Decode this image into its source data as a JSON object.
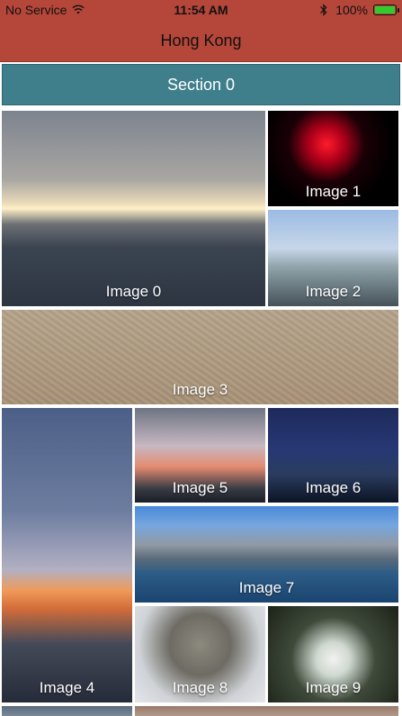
{
  "status_bar": {
    "carrier": "No Service",
    "time": "11:54 AM",
    "battery": "100%",
    "icons": [
      "wifi-icon",
      "bluetooth-icon",
      "battery-icon"
    ]
  },
  "nav": {
    "title": "Hong Kong"
  },
  "section": {
    "title": "Section 0"
  },
  "images": [
    {
      "caption": "Image 0"
    },
    {
      "caption": "Image 1"
    },
    {
      "caption": "Image 2"
    },
    {
      "caption": "Image 3"
    },
    {
      "caption": "Image 4"
    },
    {
      "caption": "Image 5"
    },
    {
      "caption": "Image 6"
    },
    {
      "caption": "Image 7"
    },
    {
      "caption": "Image 8"
    },
    {
      "caption": "Image 9"
    }
  ],
  "colors": {
    "bar": "#b5463a",
    "section": "#3f7f8c"
  }
}
